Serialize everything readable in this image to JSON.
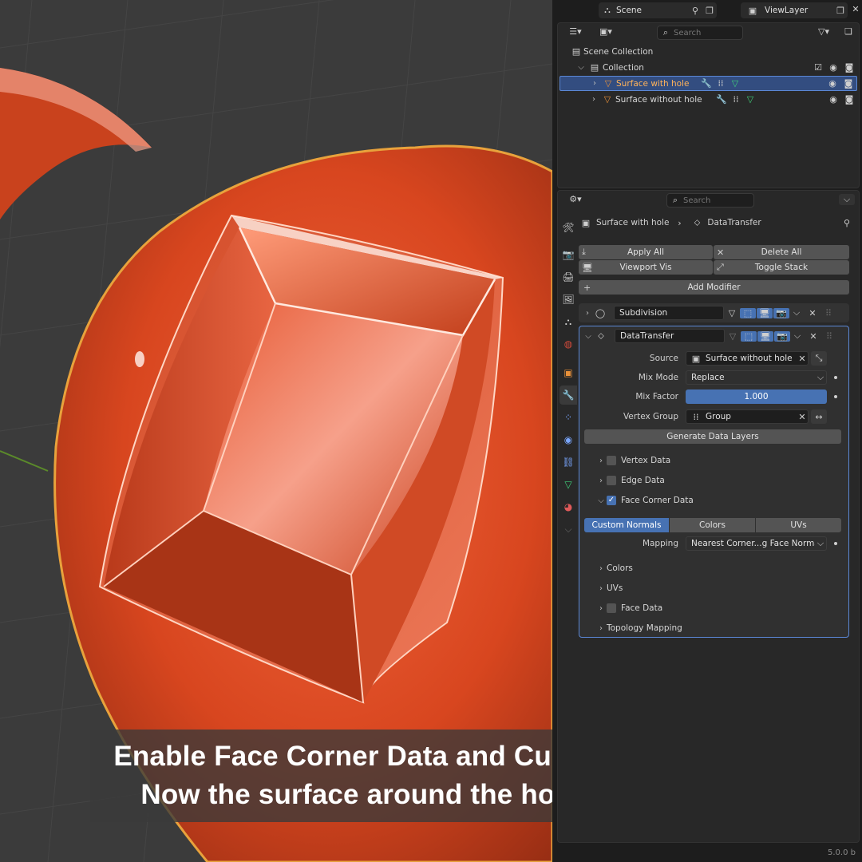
{
  "topbar": {
    "scene_label": "Scene",
    "viewlayer_label": "ViewLayer"
  },
  "outliner": {
    "search_placeholder": "Search",
    "rows": [
      {
        "label": "Scene Collection"
      },
      {
        "label": "Collection"
      },
      {
        "label": "Surface with hole"
      },
      {
        "label": "Surface without hole"
      }
    ]
  },
  "properties": {
    "search_placeholder": "Search",
    "breadcrumb": {
      "object": "Surface with hole",
      "modifier": "DataTransfer"
    },
    "buttons": {
      "apply_all": "Apply All",
      "delete_all": "Delete All",
      "viewport_vis": "Viewport Vis",
      "toggle_stack": "Toggle Stack",
      "add_modifier": "Add Modifier"
    },
    "modifiers": [
      {
        "name": "Subdivision",
        "expanded": false
      },
      {
        "name": "DataTransfer",
        "expanded": true
      }
    ],
    "datatransfer": {
      "source_label": "Source",
      "source_value": "Surface without hole",
      "mix_mode_label": "Mix Mode",
      "mix_mode_value": "Replace",
      "mix_factor_label": "Mix Factor",
      "mix_factor_value": "1.000",
      "vertex_group_label": "Vertex Group",
      "vertex_group_value": "Group",
      "generate_label": "Generate Data Layers",
      "vertex_data": "Vertex Data",
      "edge_data": "Edge Data",
      "face_corner_data": "Face Corner Data",
      "face_corner_checked": true,
      "tabs": [
        "Custom Normals",
        "Colors",
        "UVs"
      ],
      "active_tab": "Custom Normals",
      "mapping_label": "Mapping",
      "mapping_value": "Nearest Corner...g Face Normal",
      "colors": "Colors",
      "uvs": "UVs",
      "face_data": "Face Data",
      "topology_mapping": "Topology Mapping"
    }
  },
  "caption": {
    "line1": "Enable Face Corner Data and Custom Normals.",
    "line2": "Now the surface around the hole is perfect."
  },
  "version": "5.0.0 b",
  "colors": {
    "accent": "#4772b3",
    "selection": "#334d80",
    "object_orange": "#d6451f",
    "viewport_bg": "#3b3b3b"
  }
}
